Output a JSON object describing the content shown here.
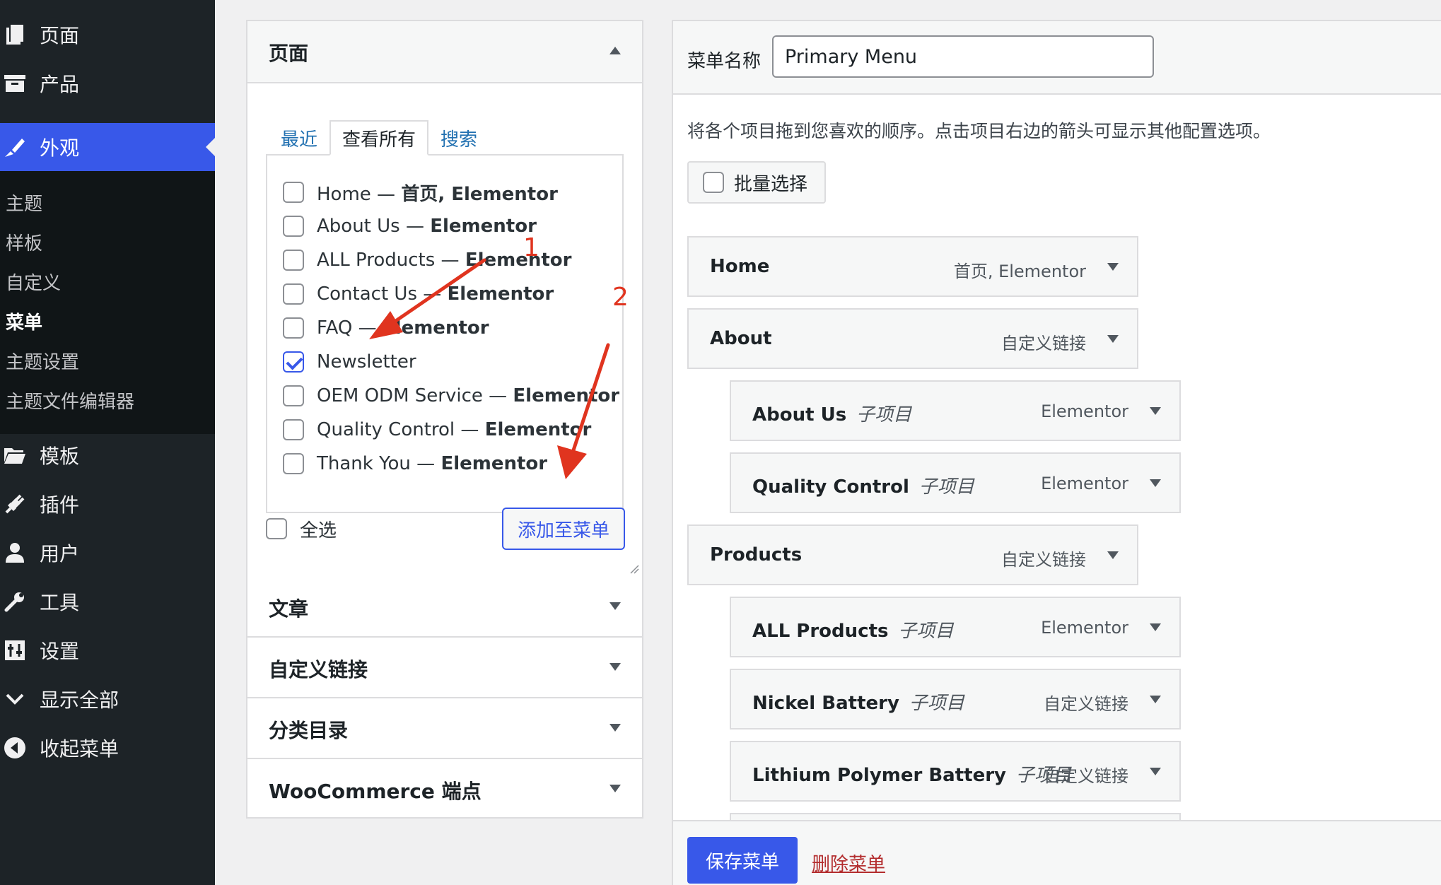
{
  "sidebar": {
    "items": [
      {
        "label": "页面",
        "icon": "pages-icon"
      },
      {
        "label": "产品",
        "icon": "archive-icon"
      },
      {
        "label": "外观",
        "icon": "appearance-brush-icon",
        "active": true
      },
      {
        "label": "模板",
        "icon": "folder-icon"
      },
      {
        "label": "插件",
        "icon": "plugins-icon"
      },
      {
        "label": "用户",
        "icon": "user-icon"
      },
      {
        "label": "工具",
        "icon": "wrench-icon"
      },
      {
        "label": "设置",
        "icon": "settings-sliders-icon"
      },
      {
        "label": "显示全部",
        "icon": "chevron-down-icon"
      },
      {
        "label": "收起菜单",
        "icon": "collapse-icon"
      }
    ],
    "submenu": [
      "主题",
      "样板",
      "自定义",
      "菜单",
      "主题设置",
      "主题文件编辑器"
    ],
    "submenu_current": "菜单"
  },
  "add_items": {
    "pages": {
      "title": "页面",
      "tabs": [
        "最近",
        "查看所有",
        "搜索"
      ],
      "active_tab": "查看所有",
      "items": [
        {
          "name": "Home",
          "suffix": " — ",
          "post_state": "首页, Elementor",
          "checked": false
        },
        {
          "name": "About Us",
          "suffix": " — ",
          "post_state": "Elementor",
          "checked": false
        },
        {
          "name": "ALL Products",
          "suffix": " — ",
          "post_state": "Elementor",
          "checked": false
        },
        {
          "name": "Contact Us",
          "suffix": " — ",
          "post_state": "Elementor",
          "checked": false
        },
        {
          "name": "FAQ",
          "suffix": " — ",
          "post_state": "Elementor",
          "checked": false
        },
        {
          "name": "Newsletter",
          "suffix": "",
          "post_state": "",
          "checked": true
        },
        {
          "name": "OEM ODM Service",
          "suffix": " — ",
          "post_state": "Elementor",
          "checked": false
        },
        {
          "name": "Quality Control",
          "suffix": " — ",
          "post_state": "Elementor",
          "checked": false
        },
        {
          "name": "Thank You",
          "suffix": " — ",
          "post_state": "Elementor",
          "checked": false
        }
      ],
      "select_all": "全选",
      "add_button": "添加至菜单"
    },
    "sections": [
      "文章",
      "自定义链接",
      "分类目录",
      "WooCommerce 端点"
    ]
  },
  "menu": {
    "name_label": "菜单名称",
    "name_value": "Primary Menu",
    "instructions": "将各个项目拖到您喜欢的顺序。点击项目右边的箭头可显示其他配置选项。",
    "bulk_select": "批量选择",
    "sub_item_label": "子项目",
    "items": [
      {
        "title": "Home",
        "type": "首页, Elementor",
        "depth": 0
      },
      {
        "title": "About",
        "type": "自定义链接",
        "depth": 0
      },
      {
        "title": "About Us",
        "type": "Elementor",
        "depth": 1
      },
      {
        "title": "Quality Control",
        "type": "Elementor",
        "depth": 1
      },
      {
        "title": "Products",
        "type": "自定义链接",
        "depth": 0
      },
      {
        "title": "ALL Products",
        "type": "Elementor",
        "depth": 1
      },
      {
        "title": "Nickel Battery",
        "type": "自定义链接",
        "depth": 1
      },
      {
        "title": "Lithium Polymer Battery",
        "type": "自定义链接",
        "depth": 1
      }
    ],
    "save_button": "保存菜单",
    "delete_link": "删除菜单"
  },
  "annotations": {
    "one": "1",
    "two": "2",
    "color": "#e0341f"
  },
  "colors": {
    "accent": "#3858e9",
    "sidebar_bg": "#1d2327",
    "delete": "#b32d2e"
  }
}
